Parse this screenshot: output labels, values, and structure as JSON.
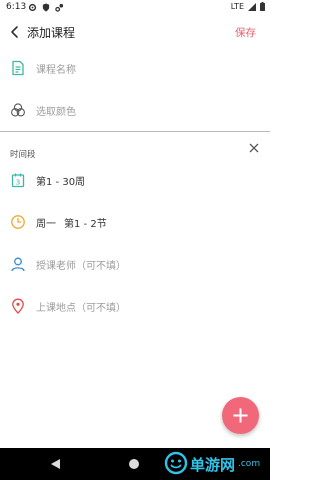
{
  "status_bar": {
    "time": "6:13",
    "network": "LTE"
  },
  "header": {
    "title": "添加课程",
    "save_label": "保存"
  },
  "form": {
    "course_name_placeholder": "课程名称",
    "color_placeholder": "选取颜色"
  },
  "section": {
    "label": "时间段",
    "weeks": "第1 - 30周",
    "day": "周一",
    "periods": "第1 - 2节",
    "teacher_placeholder": "授课老师（可不填）",
    "location_placeholder": "上课地点（可不填）",
    "calendar_icon_number": "3"
  },
  "watermark": {
    "text": "单游网",
    "logo_text": ".com"
  },
  "colors": {
    "accent": "#e75f6d",
    "fab": "#f0687a",
    "teal": "#3cb7a4",
    "orange": "#f0a830",
    "blue": "#3b8bd6",
    "red": "#e24c4c"
  }
}
